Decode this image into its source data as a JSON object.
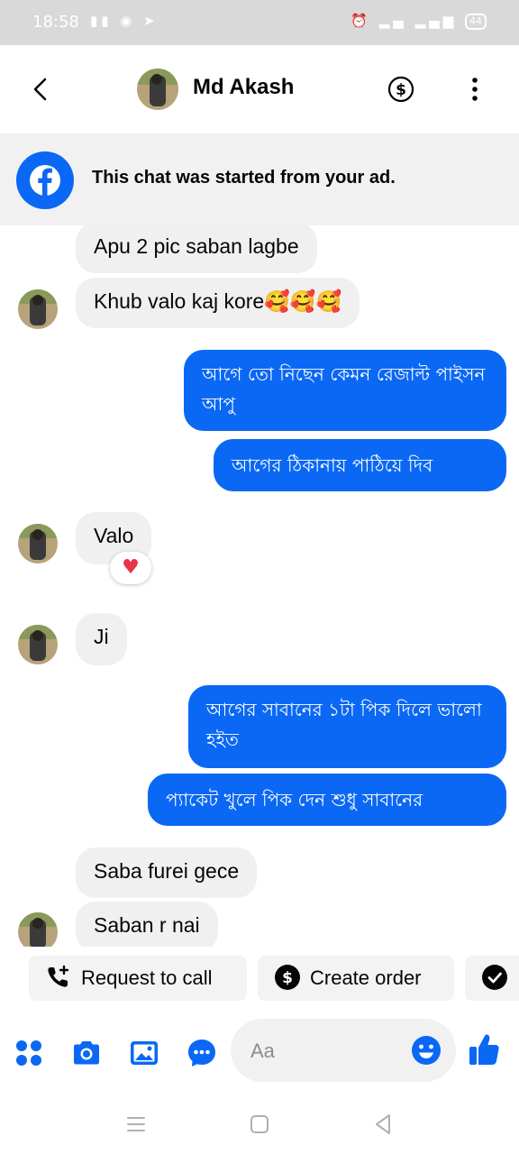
{
  "status_bar": {
    "time": "18:58",
    "battery": "44"
  },
  "header": {
    "contact_name": "Md Akash"
  },
  "ad_banner": {
    "text": "This chat was started from your ad."
  },
  "messages": [
    {
      "side": "in",
      "text": "Apu 2 pic saban lagbe"
    },
    {
      "side": "in",
      "text": "Khub valo kaj kore🥰🥰🥰"
    },
    {
      "side": "out",
      "text": "আগে তো নিছেন কেমন রেজাল্ট পাইসন আপু"
    },
    {
      "side": "out",
      "text": "আগের ঠিকানায় পাঠিয়ে দিব"
    },
    {
      "side": "in",
      "text": "Valo",
      "reaction": "♥"
    },
    {
      "side": "in",
      "text": "Ji"
    },
    {
      "side": "out",
      "text": "আগের সাবানের ১টা পিক দিলে ভালো হইত"
    },
    {
      "side": "out",
      "text": "প্যাকেট খুলে পিক দেন শুধু সাবানের"
    },
    {
      "side": "in",
      "text": "Saba furei gece"
    },
    {
      "side": "in",
      "text": "Saban r nai"
    }
  ],
  "quick_replies": [
    {
      "label": "Request to call",
      "icon": "phone-plus-icon"
    },
    {
      "label": "Create order",
      "icon": "dollar-circle-icon"
    },
    {
      "label": "",
      "icon": "check-circle-icon"
    }
  ],
  "composer": {
    "placeholder": "Aa"
  },
  "colors": {
    "accent": "#0a68f5",
    "incoming_bubble": "#f0f0f0",
    "status_bar": "#d9d9d9",
    "ad_bar": "#f1f1f2",
    "heart": "#e8334b"
  }
}
